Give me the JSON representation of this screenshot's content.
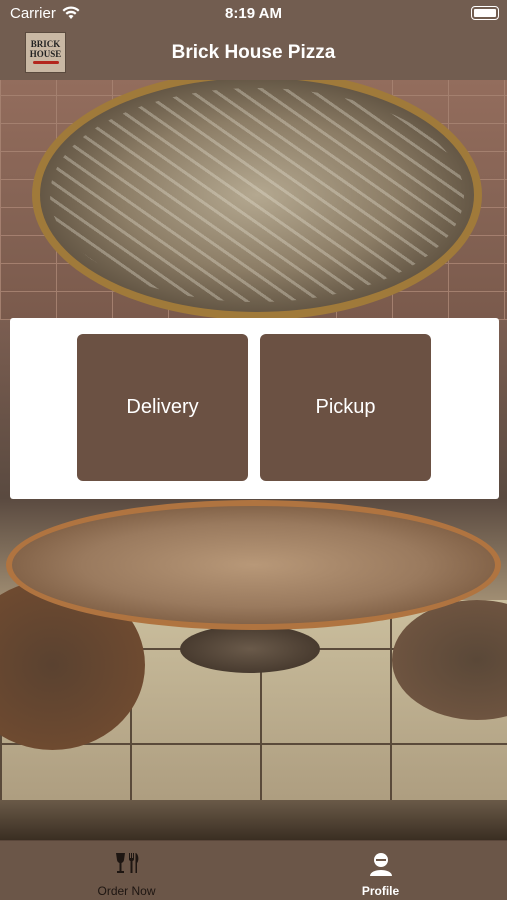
{
  "status_bar": {
    "carrier": "Carrier",
    "time": "8:19 AM",
    "wifi_icon": "wifi-icon",
    "battery_icon": "battery-icon"
  },
  "nav_bar": {
    "title": "Brick House Pizza",
    "logo": {
      "line1": "BRICK",
      "line2": "HOUSE"
    }
  },
  "order_options": {
    "delivery_label": "Delivery",
    "pickup_label": "Pickup"
  },
  "tab_bar": {
    "tabs": [
      {
        "label": "Order Now",
        "icon": "utensils-icon",
        "selected": false
      },
      {
        "label": "Profile",
        "icon": "person-icon",
        "selected": true
      }
    ]
  },
  "colors": {
    "brand": "#725d50",
    "button": "#6b5143",
    "tab_bar": "#6b5648",
    "card": "#ffffff",
    "text_on_brand": "#ffffff"
  }
}
